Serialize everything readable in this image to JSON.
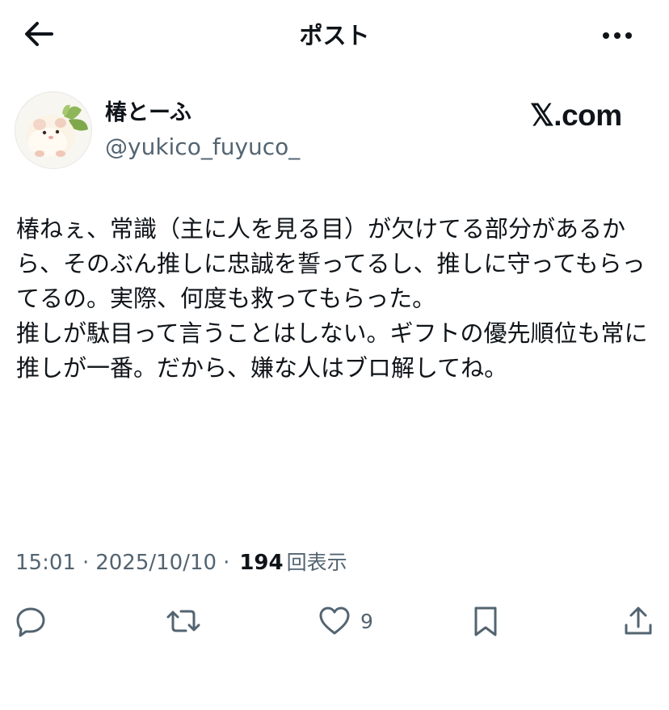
{
  "header": {
    "title": "ポスト",
    "back_icon": "arrow-left-icon",
    "more_icon": "more-horizontal-icon"
  },
  "author": {
    "display_name": "椿とーふ",
    "handle": "@yukico_fuyuco_",
    "avatar_icon": "hamster-avatar"
  },
  "watermark": "𝕏.com",
  "post": {
    "text": "椿ねぇ、常識（主に人を見る目）が欠けてる部分があるから、そのぶん推しに忠誠を誓ってるし、推しに守ってもらってるの。実際、何度も救ってもらった。\n推しが駄目って言うことはしない。ギフトの優先順位も常に推しが一番。だから、嫌な人はブロ解してね。"
  },
  "meta": {
    "time": "15:01",
    "separator": "·",
    "date": "2025/10/10",
    "views_count": "194",
    "views_label": "回表示"
  },
  "actions": {
    "reply_icon": "reply-icon",
    "repost_icon": "repost-icon",
    "like_icon": "heart-icon",
    "like_count": "9",
    "bookmark_icon": "bookmark-icon",
    "share_icon": "share-icon"
  },
  "colors": {
    "text": "#0f1419",
    "secondary": "#536471",
    "background": "#ffffff"
  }
}
